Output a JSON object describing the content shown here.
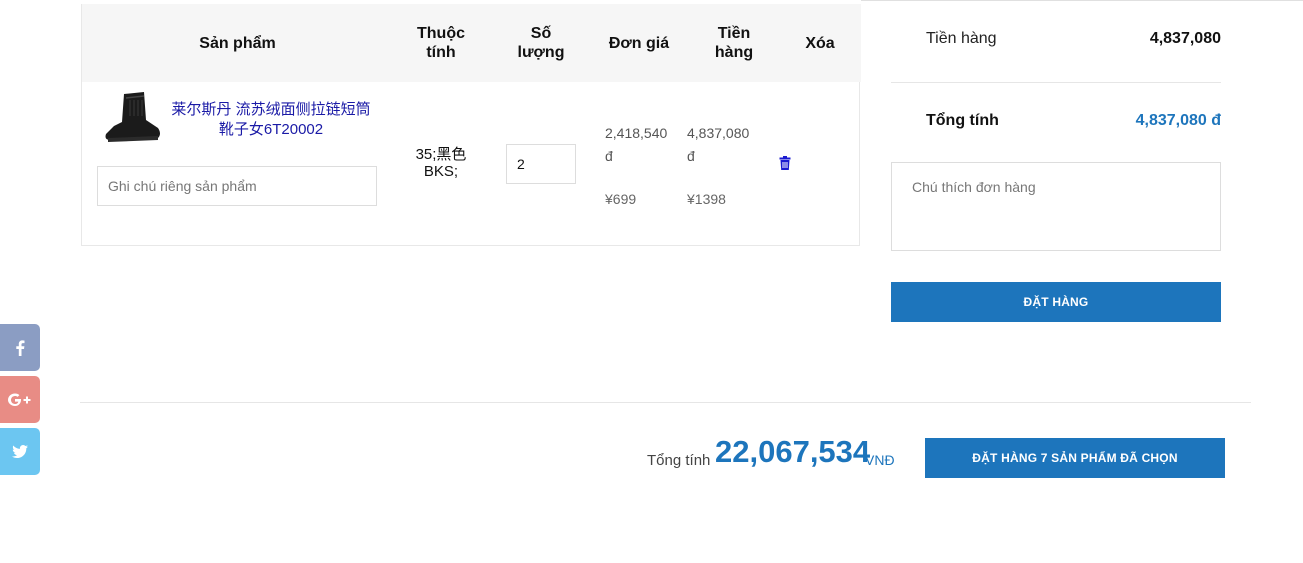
{
  "cart": {
    "headers": {
      "product": "Sản phẩm",
      "attribute": "Thuộc\ntính",
      "quantity": "Số\nlượng",
      "unit_price": "Đơn giá",
      "amount": "Tiền\nhàng",
      "delete": "Xóa"
    },
    "item": {
      "name": "莱尔斯丹 流苏绒面侧拉链短筒靴子女6T20002",
      "note_placeholder": "Ghi chú riêng sản phẩm",
      "attributes": "35;黑色 BKS;",
      "quantity": "2",
      "unit_price_vnd": "2,418,540",
      "unit_price_currency": "đ",
      "unit_price_cny": "¥699",
      "amount_vnd": "4,837,080",
      "amount_currency": "đ",
      "amount_cny": "¥1398"
    }
  },
  "summary": {
    "goods_label": "Tiền hàng",
    "goods_value": "4,837,080",
    "total_label": "Tổng tính",
    "total_value": "4,837,080 đ",
    "order_note_placeholder": "Chú thích đơn hàng",
    "order_button": "ĐẶT HÀNG"
  },
  "footer": {
    "grand_label": "Tổng tính",
    "grand_value": "22,067,534",
    "grand_unit": "VNĐ",
    "order_all_button": "ĐẶT HÀNG 7 SẢN PHẨM ĐÃ CHỌN"
  },
  "social": [
    {
      "name": "facebook-icon",
      "color": "#8b9dc3"
    },
    {
      "name": "google-plus-icon",
      "color": "#e88c85"
    },
    {
      "name": "twitter-icon",
      "color": "#6cc6f1"
    }
  ],
  "colors": {
    "accent": "#1d75bc",
    "product_link": "#1a1aa6",
    "delete_icon": "#1a1ad0"
  }
}
